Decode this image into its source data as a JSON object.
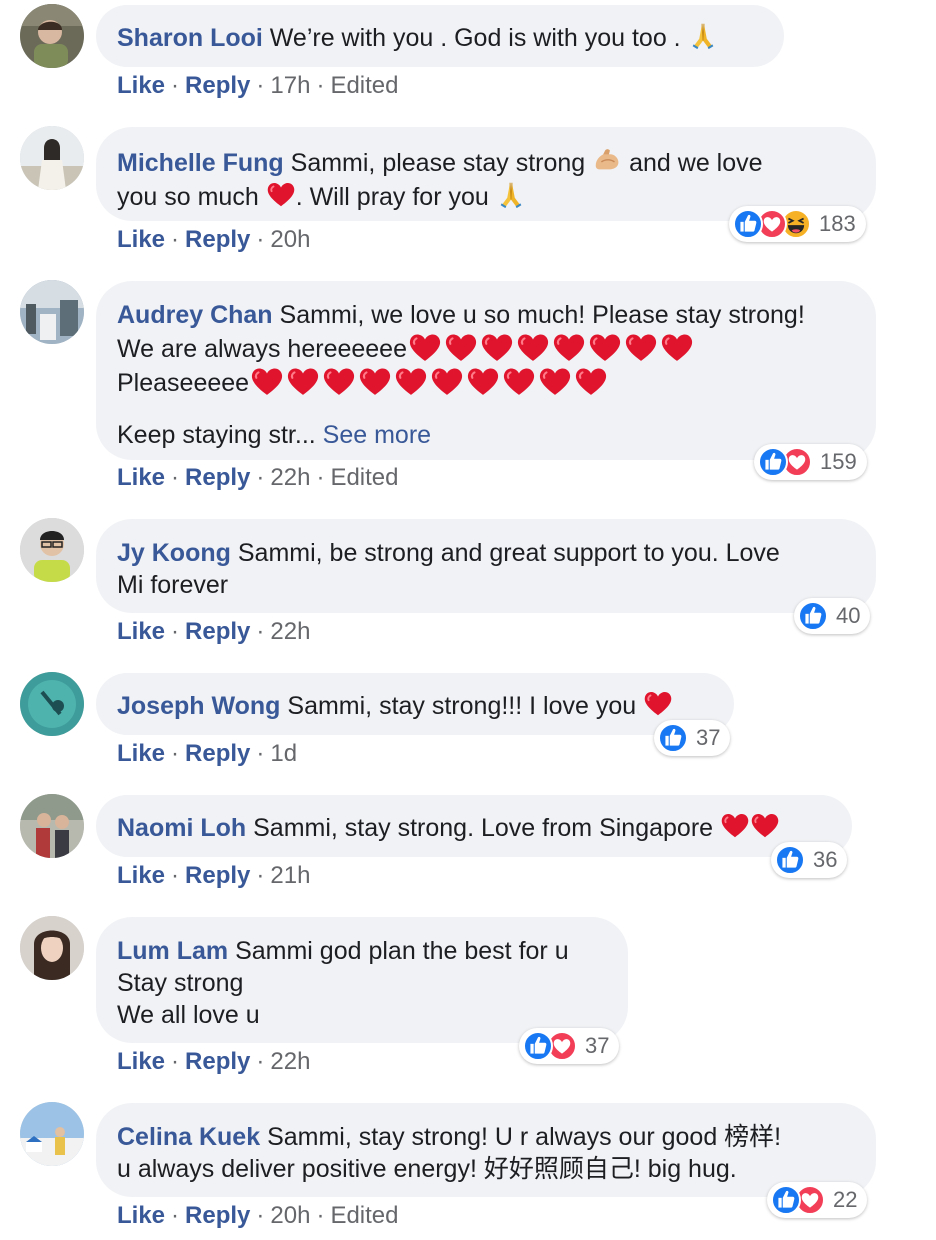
{
  "actions": {
    "like": "Like",
    "reply": "Reply",
    "dot": "·",
    "edited": "Edited"
  },
  "comments": [
    {
      "author": "Sharon Looi",
      "lines": [
        "We’re with you . God is with you too . "
      ],
      "time": "17h",
      "edited": true,
      "reactions": null
    },
    {
      "author": "Michelle Fung",
      "lines": [
        "Sammi, please stay strong ",
        " and we love",
        "you so much ",
        ". Will pray for you "
      ],
      "time": "20h",
      "edited": false,
      "reactions": {
        "types": [
          "like",
          "love",
          "haha"
        ],
        "count": "183"
      }
    },
    {
      "author": "Audrey Chan",
      "lines": [
        "Sammi, we love u so much! Please stay strong!",
        "We are always hereeeeee",
        "Pleaseeeee",
        "Keep staying str... "
      ],
      "see_more": "See more",
      "time": "22h",
      "edited": true,
      "reactions": {
        "types": [
          "like",
          "love"
        ],
        "count": "159"
      }
    },
    {
      "author": "Jy Koong",
      "lines": [
        "Sammi, be strong and great support to you. Love",
        "Mi forever"
      ],
      "time": "22h",
      "edited": false,
      "reactions": {
        "types": [
          "like"
        ],
        "count": "40"
      }
    },
    {
      "author": "Joseph Wong",
      "lines": [
        "Sammi, stay strong!!! I love you "
      ],
      "time": "1d",
      "edited": false,
      "reactions": {
        "types": [
          "like"
        ],
        "count": "37"
      }
    },
    {
      "author": "Naomi Loh",
      "lines": [
        "Sammi, stay strong. Love from Singapore "
      ],
      "time": "21h",
      "edited": false,
      "reactions": {
        "types": [
          "like"
        ],
        "count": "36"
      }
    },
    {
      "author": "Lum Lam",
      "lines": [
        "Sammi god plan the best for u",
        "Stay strong",
        "We all love u"
      ],
      "time": "22h",
      "edited": false,
      "reactions": {
        "types": [
          "like",
          "love"
        ],
        "count": "37"
      }
    },
    {
      "author": "Celina Kuek",
      "lines": [
        "Sammi, stay strong! U r always our good 榜样!",
        "u always deliver positive energy! 好好照顾自己!  big hug."
      ],
      "time": "20h",
      "edited": true,
      "reactions": {
        "types": [
          "like",
          "love"
        ],
        "count": "22"
      }
    }
  ],
  "icons": {
    "praying_hands": "praying-hands-icon",
    "flexed_biceps": "flexed-biceps-icon",
    "red_heart": "red-heart-icon",
    "like": "like-reaction-icon",
    "love": "love-reaction-icon",
    "haha": "haha-reaction-icon"
  },
  "colors": {
    "author": "#385898",
    "bubble": "#f0f2f5",
    "meta": "#65676b",
    "like": "#1877f2",
    "love": "#f33e58",
    "haha": "#f7b125"
  }
}
